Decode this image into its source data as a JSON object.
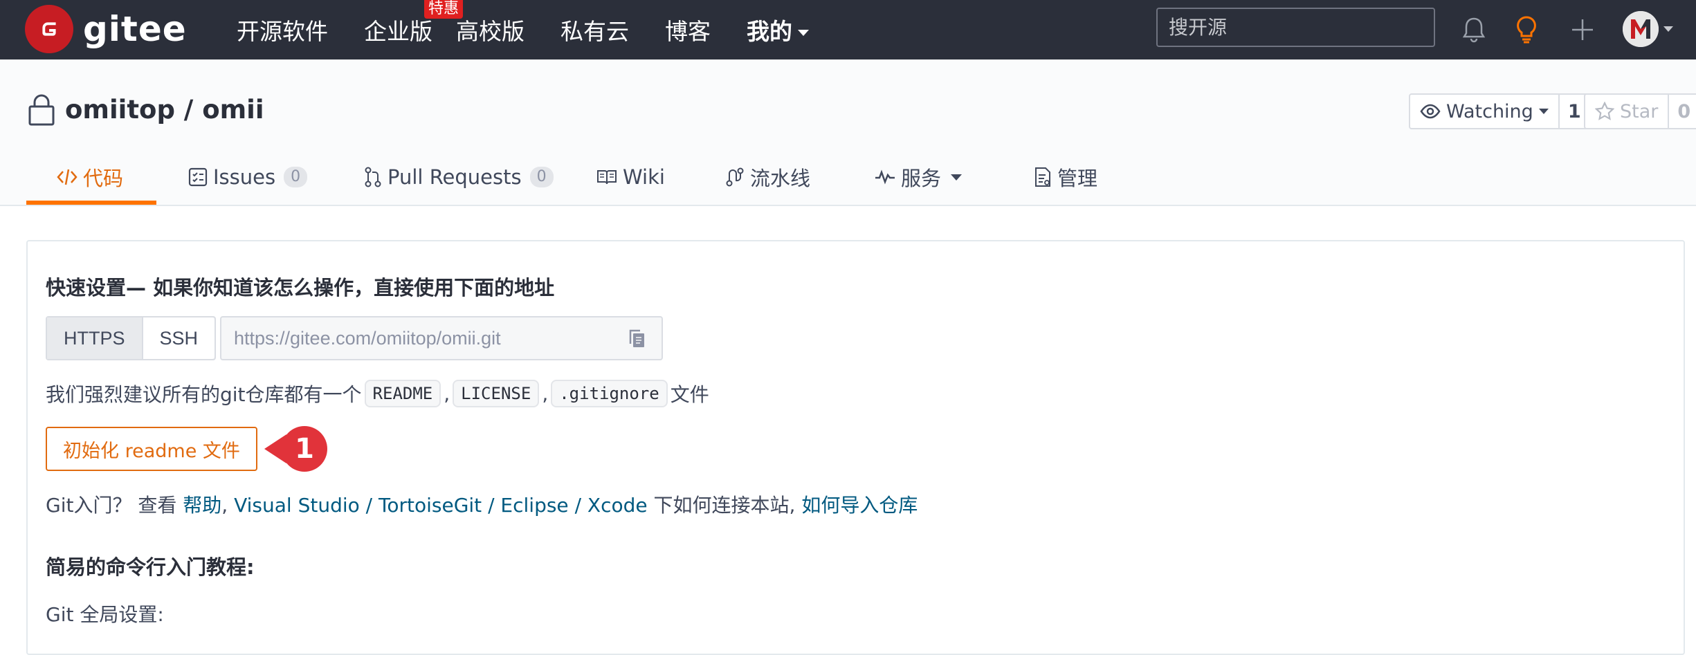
{
  "nav": {
    "logo_text": "gitee",
    "links": [
      "开源软件",
      "企业版",
      "高校版",
      "私有云",
      "博客"
    ],
    "enterprise_badge": "特惠",
    "mine_label": "我的",
    "search_placeholder": "搜开源",
    "icons": [
      "bell-icon",
      "lightbulb-icon",
      "plus-icon"
    ],
    "accent_color": "#fe7300"
  },
  "project": {
    "title": "omiitop / omii",
    "watch_label": "Watching",
    "watch_count": "1",
    "star_label": "Star",
    "star_count": "0"
  },
  "tabs": {
    "code": "代码",
    "issues": "Issues",
    "issues_count": "0",
    "pulls": "Pull Requests",
    "pulls_count": "0",
    "wiki": "Wiki",
    "pipeline": "流水线",
    "services": "服务",
    "manage": "管理"
  },
  "quickstart": {
    "heading": "快速设置— 如果你知道该怎么操作，直接使用下面的地址",
    "https_label": "HTTPS",
    "ssh_label": "SSH",
    "url": "https://gitee.com/omiitop/omii.git",
    "recommend_prefix": "我们强烈建议所有的git仓库都有一个",
    "readme": "README",
    "license": "LICENSE",
    "gitignore": ".gitignore",
    "sep": ",",
    "recommend_suffix": "文件",
    "init_button": "初始化 readme 文件",
    "marker_number": "1",
    "help_prefix": "Git入门？ 查看",
    "help_link": "帮助",
    "vs": "Visual Studio",
    "tortoise": "TortoiseGit",
    "eclipse": "Eclipse",
    "xcode": "Xcode",
    "slash": "/",
    "help_mid": "下如何连接本站,",
    "import_link": "如何导入仓库",
    "simple_title": "简易的命令行入门教程:",
    "global_settings": "Git 全局设置:"
  }
}
